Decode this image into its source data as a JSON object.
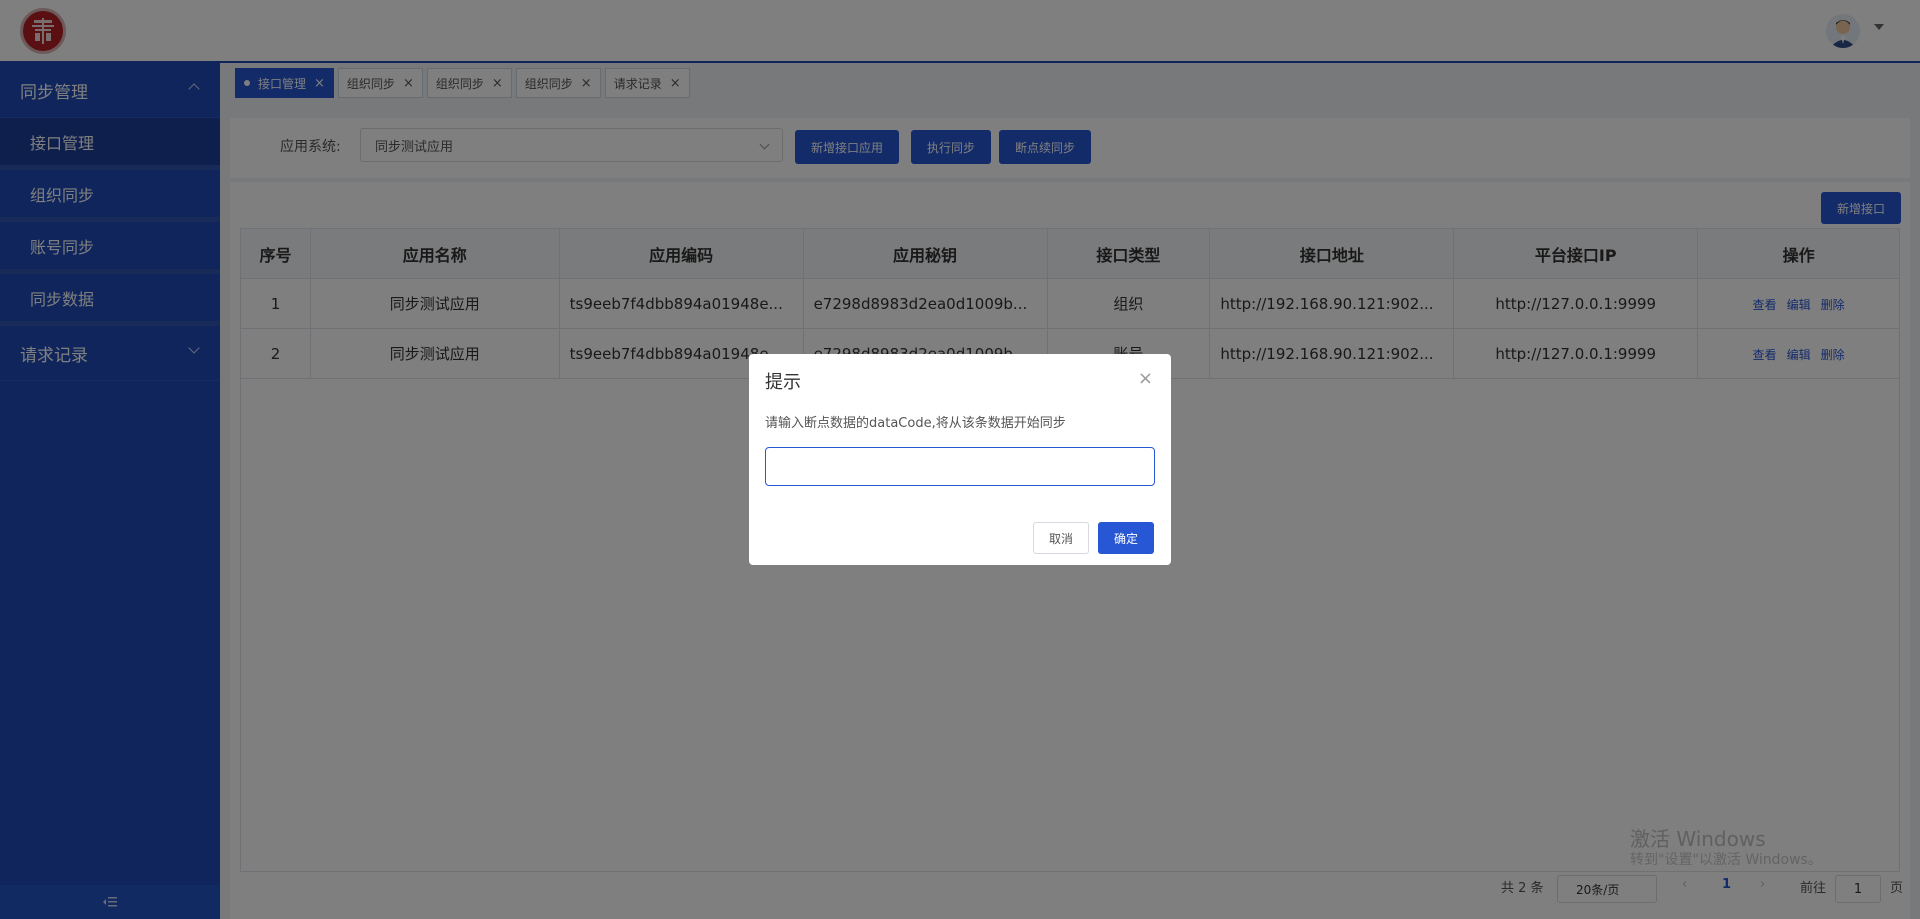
{
  "sidebar": {
    "group1": "同步管理",
    "items": [
      "接口管理",
      "组织同步",
      "账号同步",
      "同步数据"
    ],
    "group2": "请求记录",
    "collapse_icon": "collapse-icon"
  },
  "tabs": [
    "接口管理",
    "组织同步",
    "组织同步",
    "组织同步",
    "请求记录"
  ],
  "filter": {
    "label": "应用系统:",
    "selected": "同步测试应用",
    "buttons": [
      "新增接口应用",
      "执行同步",
      "断点续同步"
    ]
  },
  "panel": {
    "add_button": "新增接口"
  },
  "table": {
    "headers": [
      "序号",
      "应用名称",
      "应用编码",
      "应用秘钥",
      "接口类型",
      "接口地址",
      "平台接口IP",
      "操作"
    ],
    "rows": [
      [
        "1",
        "同步测试应用",
        "ts9eeb7f4dbb894a01948e...",
        "e7298d8983d2ea0d1009b...",
        "组织",
        "http://192.168.90.121:902...",
        "http://127.0.0.1:9999"
      ],
      [
        "2",
        "同步测试应用",
        "ts9eeb7f4dbb894a01948e...",
        "e7298d8983d2ea0d1009b...",
        "账号",
        "http://192.168.90.121:902...",
        "http://127.0.0.1:9999"
      ]
    ],
    "actions": [
      "查看",
      "编辑",
      "删除"
    ]
  },
  "pager": {
    "total": "共 2 条",
    "size": "20条/页",
    "current": "1",
    "goto_label": "前往",
    "goto_value": "1",
    "page_suffix": "页"
  },
  "watermark": {
    "line1": "激活 Windows",
    "line2": "转到\"设置\"以激活 Windows。"
  },
  "dialog": {
    "title": "提示",
    "message": "请输入断点数据的dataCode,将从该条数据开始同步",
    "input_value": "",
    "cancel": "取消",
    "ok": "确定"
  },
  "colors": {
    "primary": "#2857d5",
    "sidebar": "#1e4bb8",
    "overlay": "rgba(0,0,0,0.5)"
  }
}
